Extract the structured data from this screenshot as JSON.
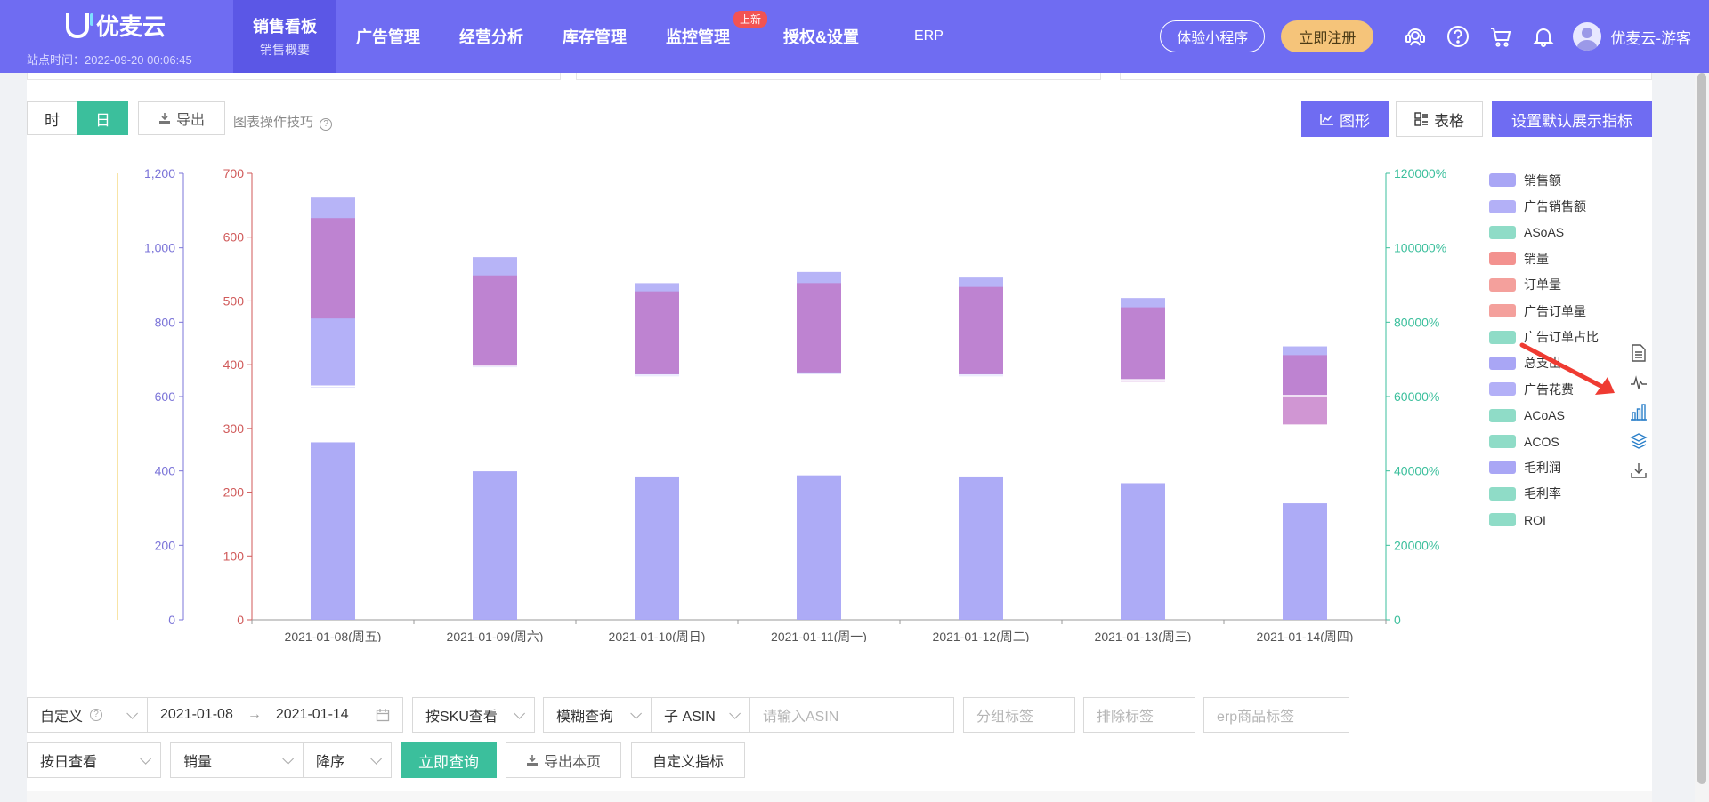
{
  "brand": {
    "name": "优麦云",
    "site_time": "站点时间：2022-09-20 00:06:45"
  },
  "nav": {
    "items": [
      {
        "label": "销售看板",
        "sub": "销售概要",
        "active": true
      },
      {
        "label": "广告管理"
      },
      {
        "label": "经营分析"
      },
      {
        "label": "库存管理"
      },
      {
        "label": "监控管理",
        "badge": "上新"
      },
      {
        "label": "授权&设置"
      },
      {
        "label": "ERP"
      }
    ]
  },
  "header": {
    "mini_program": "体验小程序",
    "register": "立即注册",
    "username": "优麦云-游客"
  },
  "toolbar": {
    "hour": "时",
    "day": "日",
    "export": "导出",
    "tip": "图表操作技巧",
    "graph": "图形",
    "table": "表格",
    "set_default": "设置默认展示指标"
  },
  "legend": [
    {
      "name": "销售额",
      "color": "#a9a6f5"
    },
    {
      "name": "广告销售额",
      "color": "#b3b0f7"
    },
    {
      "name": "ASoAS",
      "color": "#8fdcc7"
    },
    {
      "name": "销量",
      "color": "#f3928f"
    },
    {
      "name": "订单量",
      "color": "#f4a09c"
    },
    {
      "name": "广告订单量",
      "color": "#f4a09c"
    },
    {
      "name": "广告订单占比",
      "color": "#8fdcc7"
    },
    {
      "name": "总支出",
      "color": "#a9a6f5"
    },
    {
      "name": "广告花费",
      "color": "#b3b0f7"
    },
    {
      "name": "ACoAS",
      "color": "#8fdcc7"
    },
    {
      "name": "ACOS",
      "color": "#8fdcc7"
    },
    {
      "name": "毛利润",
      "color": "#a9a6f5"
    },
    {
      "name": "毛利率",
      "color": "#8fdcc7"
    },
    {
      "name": "ROI",
      "color": "#8fdcc7"
    }
  ],
  "chart_data": {
    "type": "bar",
    "categories": [
      "2021-01-08(周五)",
      "2021-01-09(周六)",
      "2021-01-10(周日)",
      "2021-01-11(周一)",
      "2021-01-12(周二)",
      "2021-01-13(周三)",
      "2021-01-14(周四)"
    ],
    "axes": {
      "left1": {
        "ticks": [
          "1,200",
          "1,000",
          "800",
          "600",
          "400",
          "200",
          "0"
        ],
        "min": 0,
        "max": 1200,
        "color": "#7b74d8"
      },
      "left2": {
        "ticks": [
          "700",
          "600",
          "500",
          "400",
          "300",
          "200",
          "100",
          "0"
        ],
        "min": 0,
        "max": 700,
        "color": "#d05a5a"
      },
      "right": {
        "ticks": [
          "120000%",
          "100000%",
          "80000%",
          "60000%",
          "40000%",
          "20000%",
          "0"
        ],
        "min": 0,
        "max": 120000,
        "color": "#3bbf9c"
      }
    },
    "series": [
      {
        "name": "销售额",
        "axis": "left1",
        "color": "#a9a6f5",
        "values": [
          477,
          399,
          385,
          388,
          385,
          367,
          313
        ]
      },
      {
        "name": "广告销售额",
        "axis": "left1",
        "color": "#b3b0f7",
        "values": [
          1135,
          975,
          905,
          935,
          920,
          865,
          735
        ]
      },
      {
        "name": "销量",
        "axis": "left2",
        "color": "#c073c4",
        "values": [
          630,
          540,
          515,
          528,
          522,
          490,
          415
        ]
      },
      {
        "name": "订单量",
        "axis": "left2",
        "color": "#c073c4",
        "values": [
          365,
          396,
          382,
          385,
          382,
          375,
          350
        ]
      },
      {
        "name": "总支出",
        "axis": "left1",
        "color": "#b3b0f7",
        "values": [
          810,
          680,
          660,
          665,
          660,
          640,
          525
        ]
      }
    ]
  },
  "filters": {
    "range_type": "自定义",
    "date_start": "2021-01-08",
    "date_sep": "→",
    "date_end": "2021-01-14",
    "view_by": "按SKU查看",
    "match": "模糊查询",
    "asin_type": "子 ASIN",
    "asin_placeholder": "请输入ASIN",
    "group_tag": "分组标签",
    "exclude_tag": "排除标签",
    "erp_tag": "erp商品标签",
    "period": "按日查看",
    "metric": "销量",
    "order": "降序",
    "query": "立即查询",
    "export_page": "导出本页",
    "custom_metric": "自定义指标"
  }
}
